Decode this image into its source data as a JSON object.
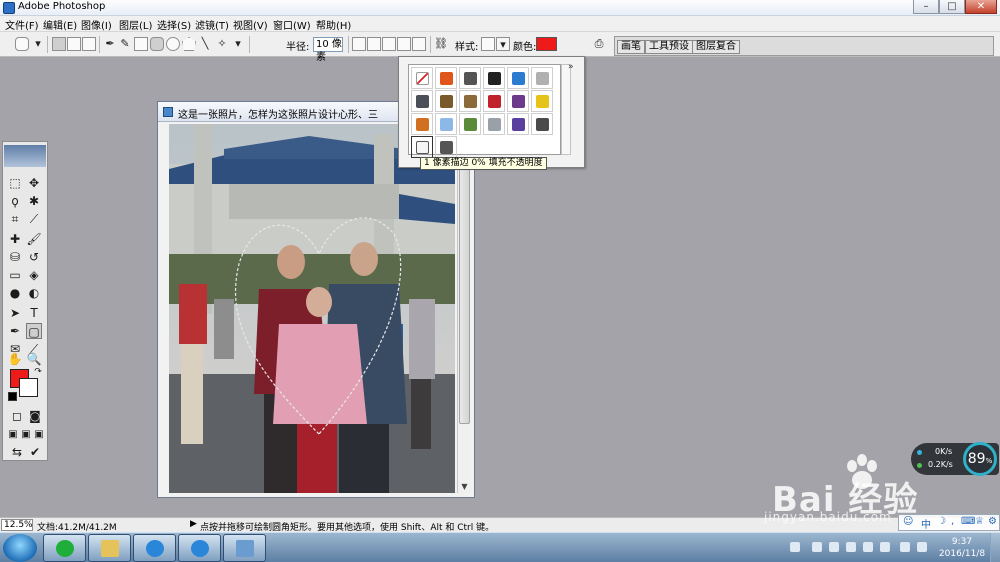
{
  "window": {
    "title": "Adobe Photoshop",
    "minimize_icon": "minimize-icon",
    "maximize_icon": "maximize-icon",
    "close_icon": "close-icon"
  },
  "menu": [
    "文件(F)",
    "编辑(E)",
    "图像(I)",
    "图层(L)",
    "选择(S)",
    "滤镜(T)",
    "视图(V)",
    "窗口(W)",
    "帮助(H)"
  ],
  "options": {
    "radius_label": "半径:",
    "radius_value": "10 像素",
    "style_label": "样式:",
    "color_label": "颜色:",
    "color": "#ef1a1a"
  },
  "palette_tabs": [
    "画笔",
    "工具预设",
    "图层复合"
  ],
  "document": {
    "title": "这是一张照片，怎样为这张照片设计心形、三角形、..."
  },
  "style_picker": {
    "menu_icon": "double-chevron-right-icon",
    "tooltip": "1 像素描边 0% 填充不透明度",
    "styles": [
      {
        "name": "none",
        "color": "#ffffff"
      },
      {
        "name": "fire",
        "color": "#e0551a"
      },
      {
        "name": "dark-gray",
        "color": "#555555"
      },
      {
        "name": "black-gloss",
        "color": "#222222"
      },
      {
        "name": "blue-glass",
        "color": "#2b7bd0"
      },
      {
        "name": "light-gray",
        "color": "#b0b0b0"
      },
      {
        "name": "steel",
        "color": "#4a4f58"
      },
      {
        "name": "bronze",
        "color": "#7a5a2a"
      },
      {
        "name": "gold-brown",
        "color": "#8b6a3a"
      },
      {
        "name": "red-gel",
        "color": "#c0212b"
      },
      {
        "name": "multicolor",
        "color": "#6b3a8a"
      },
      {
        "name": "yellow",
        "color": "#e5c318"
      },
      {
        "name": "orange-gradient",
        "color": "#d07020"
      },
      {
        "name": "sky-blue",
        "color": "#8cb8e8"
      },
      {
        "name": "landscape",
        "color": "#5a8a3a"
      },
      {
        "name": "chrome",
        "color": "#9aa0a8"
      },
      {
        "name": "purple",
        "color": "#5a3f9e"
      },
      {
        "name": "charcoal",
        "color": "#4a4a4a"
      },
      {
        "name": "outline",
        "color": "#d8d8d8"
      },
      {
        "name": "slate",
        "color": "#555555"
      }
    ],
    "selected_index": 18
  },
  "status": {
    "zoom": "12.5%",
    "doc_size": "文档:41.2M/41.2M",
    "hint": "点按并拖移可绘制圆角矩形。要用其他选项，使用 Shift、Alt 和 Ctrl 键。"
  },
  "taskbar": {
    "time": "9:37",
    "date": "2016/11/8",
    "buttons": [
      "windows-media-player",
      "file-explorer",
      "internet-explorer",
      "internet-explorer-2",
      "photoshop"
    ]
  },
  "net_widget": {
    "down_rate": "0K/s",
    "up_rate": "0.2K/s",
    "percent": "89",
    "percent_unit": "%"
  },
  "watermark": {
    "main": "Bai 经验",
    "sub": "jingyan.baidu.com"
  },
  "ime": {
    "label": "中"
  },
  "colors": {
    "foreground": "#ef1a1a",
    "background": "#ffffff",
    "taskbar": "#6f8fb2",
    "canvas_bg": "#a4a3a9"
  }
}
